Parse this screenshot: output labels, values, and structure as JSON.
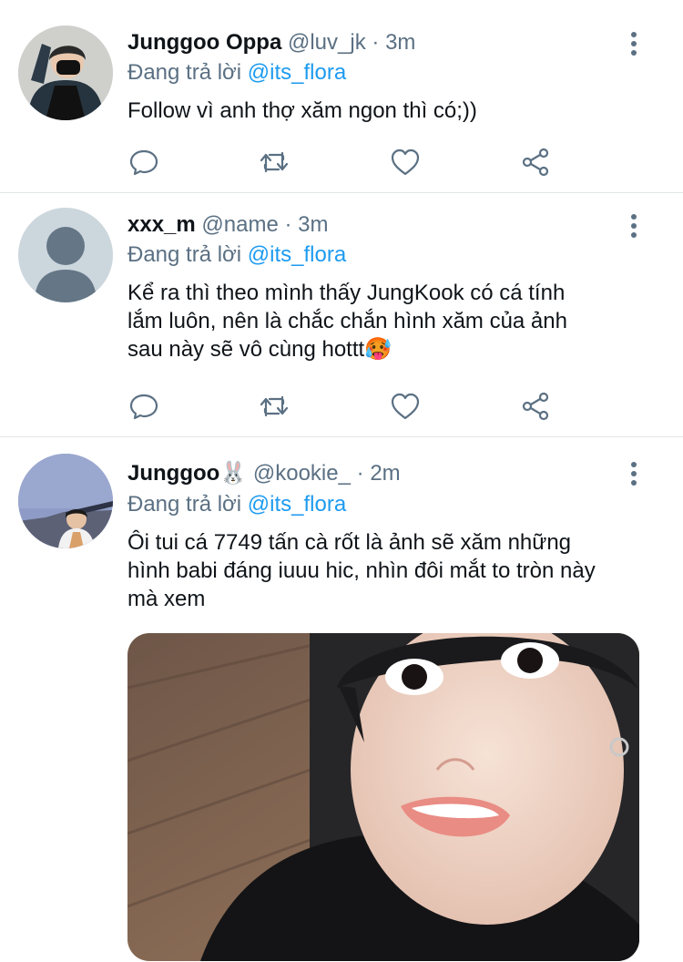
{
  "tweets": [
    {
      "name": "Junggoo Oppa",
      "handle": "@luv_jk",
      "dot": "·",
      "time": "3m",
      "reply_prefix": "Đang trả lời",
      "reply_to": "@its_flora",
      "text_lines": [
        "Follow vì anh thợ xăm ngon thì có;))"
      ],
      "avatar_icon": "profile-photo-masked"
    },
    {
      "name": "xxx_m",
      "handle": "@name",
      "dot": "·",
      "time": "3m",
      "reply_prefix": "Đang trả lời",
      "reply_to": "@its_flora",
      "text_lines": [
        "Kể ra thì theo mình thấy JungKook có cá tính",
        "lắm luôn, nên là chắc chắn hình xăm của ảnh",
        "sau này sẽ vô cùng hottt🥵"
      ],
      "avatar_icon": "default-profile-icon"
    },
    {
      "name": "Junggoo🐰",
      "handle": "@kookie_",
      "dot": "·",
      "time": "2m",
      "reply_prefix": "Đang trả lời",
      "reply_to": "@its_flora",
      "text_lines": [
        "Ôi tui cá 7749 tấn cà rốt là ảnh sẽ xăm những",
        "hình babi đáng iuuu hic, nhìn đôi mắt to tròn này",
        "mà xem"
      ],
      "avatar_icon": "profile-photo-bridge"
    }
  ],
  "colors": {
    "secondary_text": "#5b7083",
    "mention": "#1d9bf0",
    "divider": "#e3e6e8",
    "icon": "#5b7083"
  },
  "action_icons": [
    "reply-icon",
    "retweet-icon",
    "like-icon",
    "share-icon"
  ]
}
